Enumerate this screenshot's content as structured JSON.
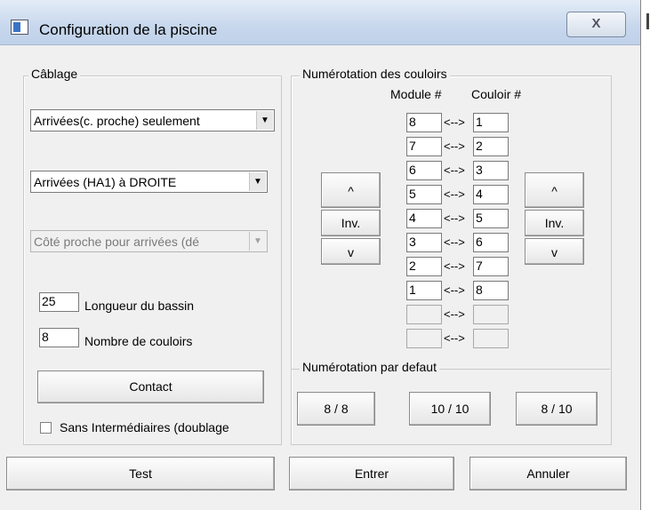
{
  "window": {
    "title": "Configuration de la piscine",
    "close_symbol": "X"
  },
  "cablage": {
    "label": "Câblage",
    "combo1": "Arrivées(c. proche) seulement",
    "combo2": "Arrivées (HA1) à DROITE",
    "combo3": "Côté proche pour arrivées (dé",
    "length_value": "25",
    "length_label": "Longueur du bassin",
    "lanes_value": "8",
    "lanes_label": "Nombre de couloirs",
    "contact_label": "Contact",
    "checkbox_label": "Sans Intermédiaires (doublage"
  },
  "numerotation": {
    "label": "Numérotation des couloirs",
    "module_header": "Module #",
    "couloir_header": "Couloir #",
    "up_label": "^",
    "inv_label": "Inv.",
    "down_label": "v",
    "separator": "<-->",
    "modules": [
      "8",
      "7",
      "6",
      "5",
      "4",
      "3",
      "2",
      "1",
      "",
      ""
    ],
    "couloirs": [
      "1",
      "2",
      "3",
      "4",
      "5",
      "6",
      "7",
      "8",
      "",
      ""
    ]
  },
  "defaults": {
    "label": "Numérotation par defaut",
    "btn1": "8 / 8",
    "btn2": "10 / 10",
    "btn3": "8 / 10"
  },
  "footer": {
    "test_label": "Test",
    "enter_label": "Entrer",
    "cancel_label": "Annuler"
  }
}
